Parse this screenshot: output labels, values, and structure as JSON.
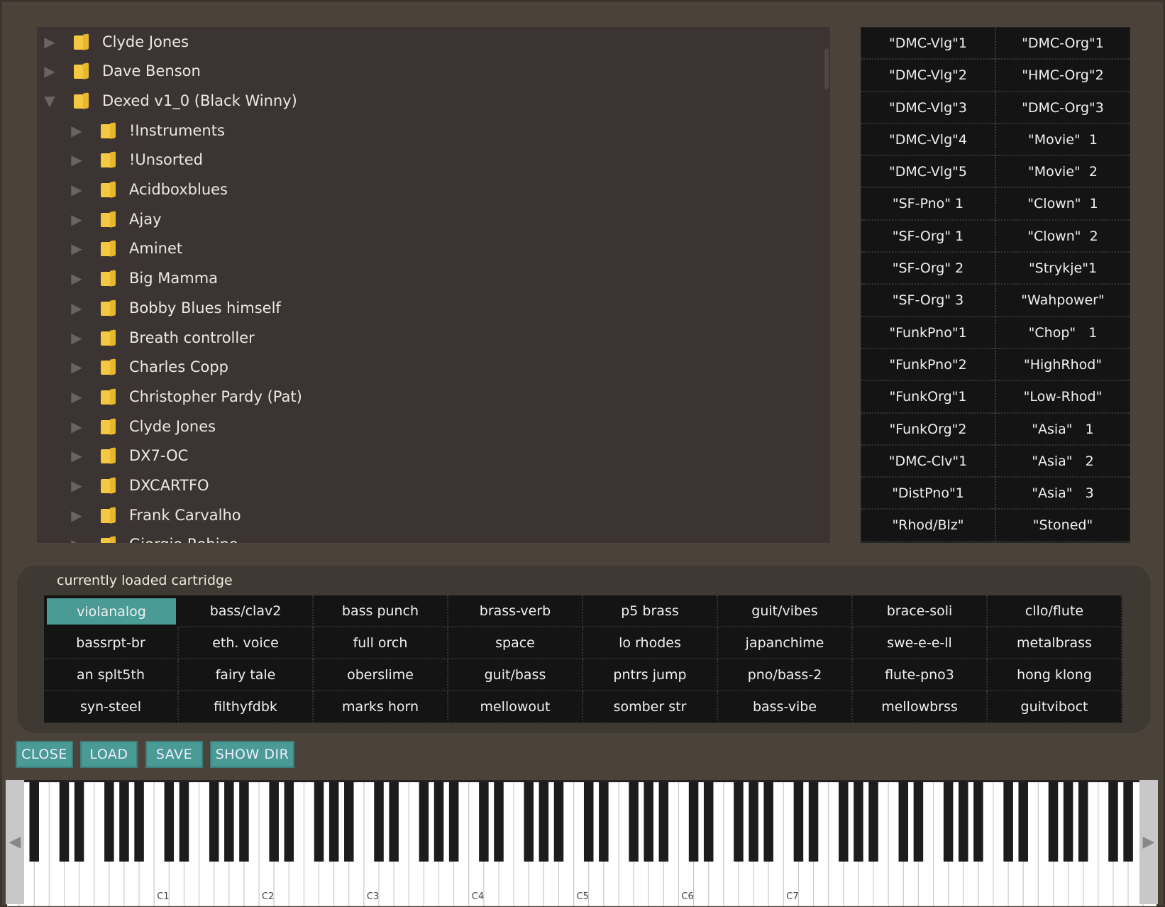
{
  "tree": {
    "items": [
      {
        "label": "Clyde Jones",
        "level": 0,
        "expanded": false
      },
      {
        "label": "Dave Benson",
        "level": 0,
        "expanded": false
      },
      {
        "label": "Dexed v1_0 (Black Winny)",
        "level": 0,
        "expanded": true
      },
      {
        "label": "!Instruments",
        "level": 1,
        "expanded": false
      },
      {
        "label": "!Unsorted",
        "level": 1,
        "expanded": false
      },
      {
        "label": "Acidboxblues",
        "level": 1,
        "expanded": false
      },
      {
        "label": "Ajay",
        "level": 1,
        "expanded": false
      },
      {
        "label": "Aminet",
        "level": 1,
        "expanded": false
      },
      {
        "label": "Big Mamma",
        "level": 1,
        "expanded": false
      },
      {
        "label": "Bobby Blues himself",
        "level": 1,
        "expanded": false
      },
      {
        "label": "Breath controller",
        "level": 1,
        "expanded": false
      },
      {
        "label": "Charles Copp",
        "level": 1,
        "expanded": false
      },
      {
        "label": "Christopher Pardy (Pat)",
        "level": 1,
        "expanded": false
      },
      {
        "label": "Clyde Jones",
        "level": 1,
        "expanded": false
      },
      {
        "label": "DX7-OC",
        "level": 1,
        "expanded": false
      },
      {
        "label": "DXCARTFO",
        "level": 1,
        "expanded": false
      },
      {
        "label": "Frank Carvalho",
        "level": 1,
        "expanded": false
      },
      {
        "label": "Giorgio Robino",
        "level": 1,
        "expanded": false
      }
    ]
  },
  "programs": {
    "col1": [
      "\"DMC-Vlg\"1",
      "\"DMC-Vlg\"2",
      "\"DMC-Vlg\"3",
      "\"DMC-Vlg\"4",
      "\"DMC-Vlg\"5",
      "\"SF-Pno\" 1",
      "\"SF-Org\" 1",
      "\"SF-Org\" 2",
      "\"SF-Org\" 3",
      "\"FunkPno\"1",
      "\"FunkPno\"2",
      "\"FunkOrg\"1",
      "\"FunkOrg\"2",
      "\"DMC-Clv\"1",
      "\"DistPno\"1",
      "\"Rhod/Blz\""
    ],
    "col2": [
      "\"DMC-Org\"1",
      "\"HMC-Org\"2",
      "\"DMC-Org\"3",
      "\"Movie\"  1",
      "\"Movie\"  2",
      "\"Clown\"  1",
      "\"Clown\"  2",
      "\"Strykje\"1",
      "\"Wahpower\"",
      "\"Chop\"   1",
      "\"HighRhod\"",
      "\"Low-Rhod\"",
      "\"Asia\"   1",
      "\"Asia\"   2",
      "\"Asia\"   3",
      "\"Stoned\""
    ]
  },
  "cartridge": {
    "label": "currently loaded cartridge",
    "selected": "violanalog",
    "cells": [
      "violanalog",
      "bass/clav2",
      "bass punch",
      "brass-verb",
      "p5 brass",
      "guit/vibes",
      "brace-soli",
      "cllo/flute",
      "bassrpt-br",
      "eth. voice",
      "full orch",
      "space",
      "lo rhodes",
      "japanchime",
      "swe-e-e-ll",
      "metalbrass",
      "an splt5th",
      "fairy tale",
      "oberslime",
      "guit/bass",
      "pntrs jump",
      "pno/bass-2",
      "flute-pno3",
      "hong klong",
      "syn-steel",
      "filthyfdbk",
      "marks horn",
      "mellowout",
      "somber str",
      "bass-vibe",
      "mellowbrss",
      "guitviboct"
    ]
  },
  "buttons": {
    "close": "CLOSE",
    "load": "LOAD",
    "save": "SAVE",
    "show_dir": "SHOW DIR"
  },
  "keyboard": {
    "octave_labels": [
      "C1",
      "C2",
      "C3",
      "C4",
      "C5",
      "C6",
      "C7"
    ],
    "nav_left": "◀",
    "nav_right": "▶"
  },
  "colors": {
    "accent": "#4a9a95",
    "background": "#4b4339",
    "folder": "#f5c842"
  }
}
